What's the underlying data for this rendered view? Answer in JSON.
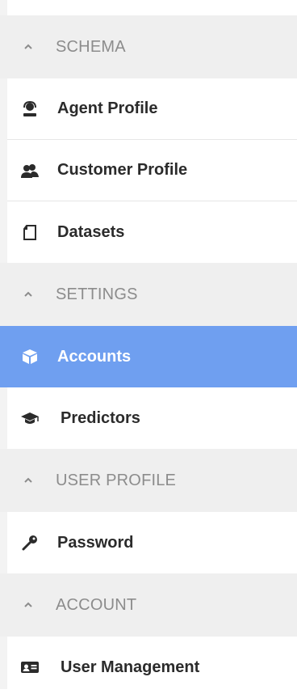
{
  "sections": [
    {
      "title": "SCHEMA",
      "items": [
        {
          "label": "Agent Profile",
          "icon": "agent-icon"
        },
        {
          "label": "Customer Profile",
          "icon": "customers-icon"
        },
        {
          "label": "Datasets",
          "icon": "datasets-icon"
        }
      ]
    },
    {
      "title": "SETTINGS",
      "items": [
        {
          "label": "Accounts",
          "icon": "cube-icon",
          "active": true
        },
        {
          "label": "Predictors",
          "icon": "graduation-cap-icon"
        }
      ]
    },
    {
      "title": "USER PROFILE",
      "items": [
        {
          "label": "Password",
          "icon": "key-icon"
        }
      ]
    },
    {
      "title": "ACCOUNT",
      "items": [
        {
          "label": "User Management",
          "icon": "id-card-icon"
        }
      ]
    }
  ],
  "colors": {
    "active_bg": "#6f9ff0",
    "header_bg": "#efefef",
    "header_text": "#8c8c8c",
    "item_text": "#2b2b2b"
  }
}
